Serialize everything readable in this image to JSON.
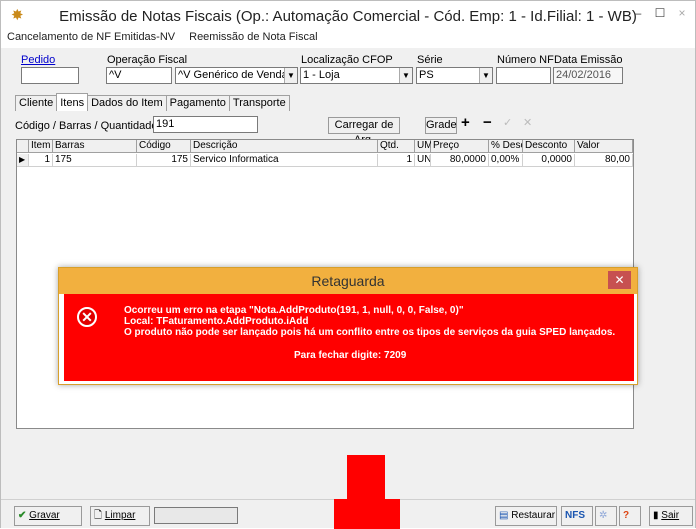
{
  "window": {
    "title": "Emissão de Notas Fiscais (Op.: Automação Comercial - Cód. Emp: 1 - Id.Filial: 1 - WB)",
    "icon": "app-icon"
  },
  "menu": [
    "Cancelamento de NF Emitidas-NV",
    "Reemissão de Nota Fiscal"
  ],
  "form": {
    "pedido_label": "Pedido",
    "pedido_value": "",
    "operacao_label": "Operação Fiscal",
    "operacao_code": "^V",
    "operacao_value": "^V Genérico de Vendas",
    "cfop_label": "Localização CFOP",
    "cfop_value": "1 - Loja",
    "serie_label": "Série",
    "serie_value": "PS",
    "numero_label": "Número NF",
    "numero_value": "",
    "data_label": "Data Emissão",
    "data_value": "24/02/2016"
  },
  "tabs": [
    "Cliente",
    "Itens",
    "Dados do Item",
    "Pagamento",
    "Transporte"
  ],
  "items": {
    "codigo_label": "Código / Barras / Quantidade *",
    "codigo_value": "191",
    "carregar_label": "Carregar de Arq.",
    "grade_label": "Grade"
  },
  "grid": {
    "headers": [
      "Item",
      "Barras",
      "Código",
      "Descrição",
      "Qtd.",
      "UM",
      "Preço",
      "% Desc",
      "Desconto",
      "Valor"
    ],
    "rows": [
      [
        "1",
        "175",
        "175",
        "Servico Informatica",
        "1",
        "UN",
        "80,0000",
        "0,00%",
        "0,0000",
        "80,00"
      ]
    ]
  },
  "dialog": {
    "title": "Retaguarda",
    "line1": "Ocorreu um erro na etapa \"Nota.AddProduto(191, 1, null, 0, 0, False, 0)\"",
    "line2": "Local: TFaturamento.AddProduto.iAdd",
    "line3": "O produto não pode ser lançado pois há um conflito entre os tipos de serviços da guia SPED lançados.",
    "line4": "Para fechar digite: 7209"
  },
  "bottom": {
    "gravar": "Gravar",
    "limpar": "Limpar",
    "restaurar": "Restaurar",
    "nfs": "NFS",
    "sair": "Sair"
  },
  "colors": {
    "dialog_header": "#f2b03f",
    "dialog_body": "#ff0000"
  }
}
